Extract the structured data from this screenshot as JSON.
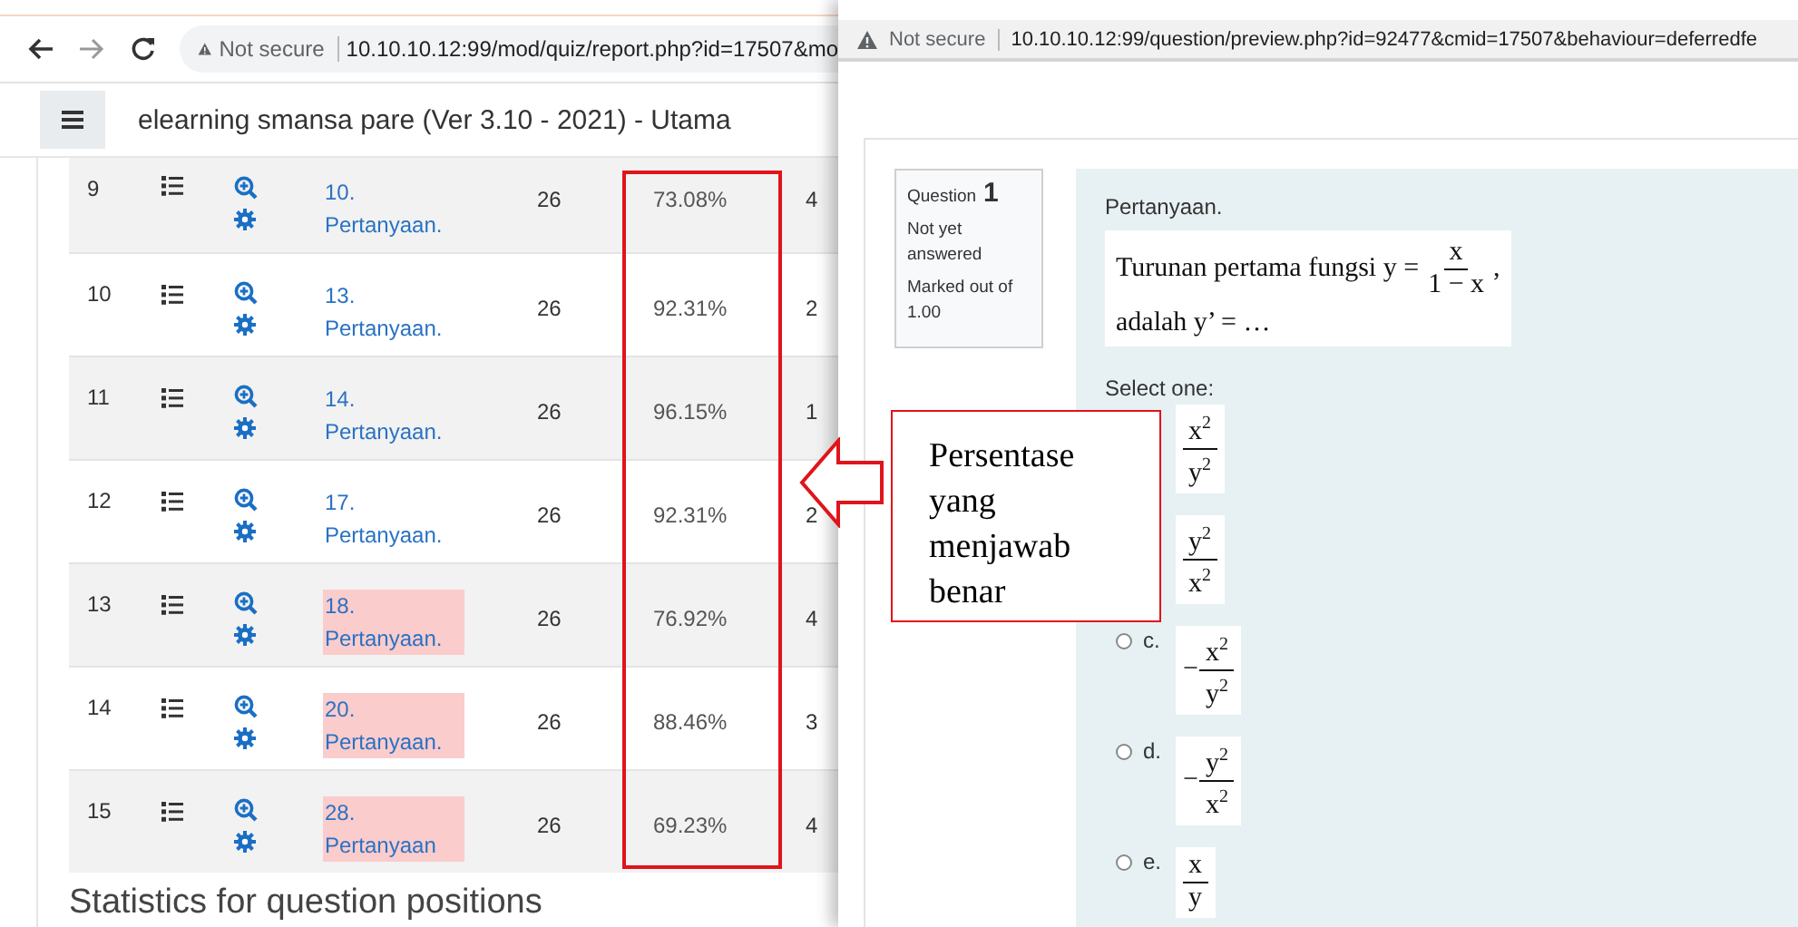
{
  "left_window": {
    "address": {
      "security": "Not secure",
      "url": "10.10.10.12:99/mod/quiz/report.php?id=17507&mo"
    },
    "site_title": "elearning smansa pare (Ver 3.10 - 2021) - Utama",
    "table": {
      "rows": [
        {
          "number": "9",
          "question_number": "10.",
          "question_name": "Pertanyaan.",
          "flagged": false,
          "attempts": "26",
          "facility": "73.08%",
          "column_7": "4"
        },
        {
          "number": "10",
          "question_number": "13.",
          "question_name": "Pertanyaan.",
          "flagged": false,
          "attempts": "26",
          "facility": "92.31%",
          "column_7": "2"
        },
        {
          "number": "11",
          "question_number": "14.",
          "question_name": "Pertanyaan.",
          "flagged": false,
          "attempts": "26",
          "facility": "96.15%",
          "column_7": "1"
        },
        {
          "number": "12",
          "question_number": "17.",
          "question_name": "Pertanyaan.",
          "flagged": false,
          "attempts": "26",
          "facility": "92.31%",
          "column_7": "2"
        },
        {
          "number": "13",
          "question_number": "18.",
          "question_name": "Pertanyaan.",
          "flagged": true,
          "attempts": "26",
          "facility": "76.92%",
          "column_7": "4"
        },
        {
          "number": "14",
          "question_number": "20.",
          "question_name": "Pertanyaan.",
          "flagged": true,
          "attempts": "26",
          "facility": "88.46%",
          "column_7": "3"
        },
        {
          "number": "15",
          "question_number": "28.",
          "question_name": "Pertanyaan",
          "flagged": true,
          "attempts": "26",
          "facility": "69.23%",
          "column_7": "4"
        }
      ]
    },
    "section_heading": "Statistics for question positions"
  },
  "right_window": {
    "address": {
      "security": "Not secure",
      "url": "10.10.10.12:99/question/preview.php?id=92477&cmid=17507&behaviour=deferredfe"
    },
    "question_info": {
      "label": "Question",
      "number": "1",
      "state": "Not yet answered",
      "mark": "Marked out of 1.00"
    },
    "question_title": "Pertanyaan.",
    "stem": {
      "before": "Turunan pertama fungsi y =",
      "numerator": "x",
      "denominator": "1 − x",
      "after": ",",
      "line2": "adalah y’ = …"
    },
    "prompt": "Select one:",
    "options": [
      {
        "numerator": "x$^{2}$",
        "denominator": "y$^{2}$"
      },
      {
        "numerator": "y$^{2}$",
        "denominator": "x$^{2}$"
      },
      {
        "label": "c.",
        "selected": false,
        "sign": "−",
        "numerator": "x$^{2}$",
        "denominator": "y$^{2}$"
      },
      {
        "label": "d.",
        "selected": false,
        "sign": "−",
        "numerator": "y$^{2}$",
        "denominator": "x$^{2}$"
      },
      {
        "label": "e.",
        "selected": false,
        "numerator": "x",
        "denominator": "y"
      }
    ]
  },
  "callout": {
    "text": "Persentase yang menjawab benar"
  }
}
